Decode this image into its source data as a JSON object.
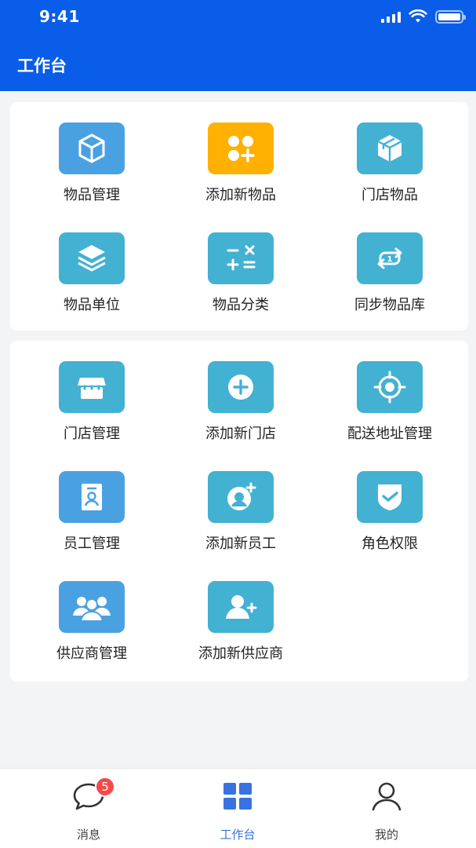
{
  "status_bar": {
    "time": "9:41"
  },
  "header": {
    "title": "工作台"
  },
  "colors": {
    "header_bg": "#0a5de8",
    "tile_blue": "#4aa1e2",
    "tile_teal": "#43b1d2",
    "tile_orange": "#ffb000",
    "active_tab": "#3872e0",
    "badge": "#f44a4a"
  },
  "sections": [
    {
      "items": [
        {
          "label": "物品管理",
          "icon": "box-icon",
          "color": "#4aa1e2"
        },
        {
          "label": "添加新物品",
          "icon": "apps-add-icon",
          "color": "#ffb000"
        },
        {
          "label": "门店物品",
          "icon": "package-icon",
          "color": "#43b1d2"
        },
        {
          "label": "物品单位",
          "icon": "layers-icon",
          "color": "#43b1d2"
        },
        {
          "label": "物品分类",
          "icon": "calculator-icon",
          "color": "#43b1d2"
        },
        {
          "label": "同步物品库",
          "icon": "sync-icon",
          "color": "#43b1d2"
        }
      ]
    },
    {
      "items": [
        {
          "label": "门店管理",
          "icon": "store-icon",
          "color": "#43b1d2"
        },
        {
          "label": "添加新门店",
          "icon": "add-circle-icon",
          "color": "#43b1d2"
        },
        {
          "label": "配送地址管理",
          "icon": "target-icon",
          "color": "#43b1d2"
        },
        {
          "label": "员工管理",
          "icon": "badge-person-icon",
          "color": "#4aa1e2"
        },
        {
          "label": "添加新员工",
          "icon": "add-person-icon",
          "color": "#43b1d2"
        },
        {
          "label": "角色权限",
          "icon": "shield-check-icon",
          "color": "#43b1d2"
        },
        {
          "label": "供应商管理",
          "icon": "group-icon",
          "color": "#4aa1e2"
        },
        {
          "label": "添加新供应商",
          "icon": "user-add-icon",
          "color": "#43b1d2"
        }
      ]
    }
  ],
  "tabbar": {
    "tabs": [
      {
        "label": "消息",
        "icon": "chat-bubble-icon",
        "badge": "5",
        "active": false
      },
      {
        "label": "工作台",
        "icon": "grid-icon",
        "active": true
      },
      {
        "label": "我的",
        "icon": "person-icon",
        "active": false
      }
    ]
  }
}
